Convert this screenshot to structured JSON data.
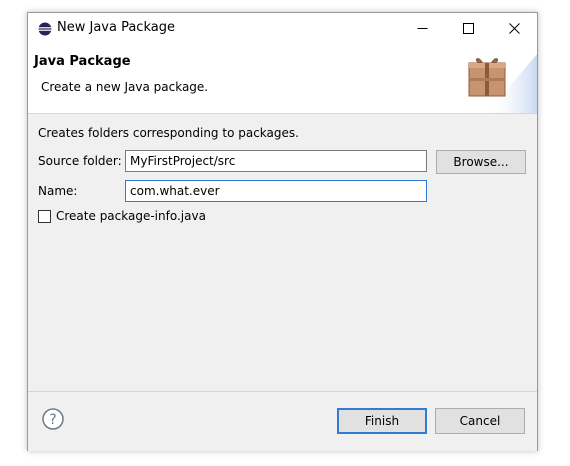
{
  "window": {
    "title": "New Java Package",
    "controls": {
      "minimize": "minimize",
      "maximize": "maximize",
      "close": "close"
    }
  },
  "header": {
    "title": "Java Package",
    "description": "Create a new Java package.",
    "icon": "package-icon"
  },
  "form": {
    "intro": "Creates folders corresponding to packages.",
    "source_folder_label": "Source folder:",
    "source_folder_value": "MyFirstProject/src",
    "browse_label": "Browse...",
    "name_label": "Name:",
    "name_value": "com.what.ever",
    "checkbox_label": "Create package-info.java",
    "checkbox_checked": false
  },
  "footer": {
    "help_icon": "help-icon",
    "finish_label": "Finish",
    "cancel_label": "Cancel"
  },
  "colors": {
    "focus": "#2f7bd5",
    "dialog_bg": "#f0f0f0",
    "header_bg": "#ffffff",
    "package_icon": "#c69470"
  }
}
